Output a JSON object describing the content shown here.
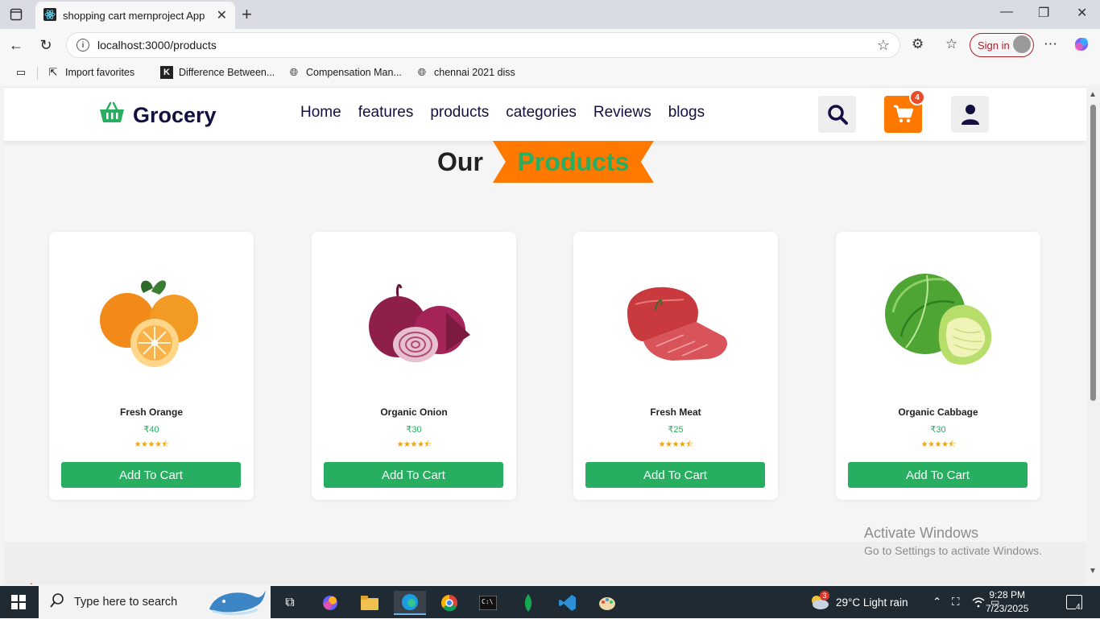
{
  "browser": {
    "tab_title": "shopping cart mernproject App",
    "url": "localhost:3000/products",
    "sign_in": "Sign in",
    "favorites": [
      {
        "label": "Import favorites",
        "icon": "import-icon"
      },
      {
        "label": "Difference Between...",
        "icon": "k-icon"
      },
      {
        "label": "Compensation Man...",
        "icon": "globe-icon"
      },
      {
        "label": "chennai 2021 diss",
        "icon": "globe-icon"
      }
    ]
  },
  "site": {
    "logo": "Grocery",
    "nav": [
      "Home",
      "features",
      "products",
      "categories",
      "Reviews",
      "blogs"
    ],
    "cart_count": "4",
    "heading_plain": "Our",
    "heading_highlight": "Products",
    "products": [
      {
        "name": "Fresh Orange",
        "price": "₹40",
        "rating": "★★★★⯪",
        "button": "Add To Cart",
        "image": "orange"
      },
      {
        "name": "Organic Onion",
        "price": "₹30",
        "rating": "★★★★⯪",
        "button": "Add To Cart",
        "image": "onion"
      },
      {
        "name": "Fresh Meat",
        "price": "₹25",
        "rating": "★★★★⯪",
        "button": "Add To Cart",
        "image": "meat"
      },
      {
        "name": "Organic Cabbage",
        "price": "₹30",
        "rating": "★★★★⯪",
        "button": "Add To Cart",
        "image": "cabbage"
      }
    ]
  },
  "watermark": {
    "line1": "Activate Windows",
    "line2": "Go to Settings to activate Windows."
  },
  "taskbar": {
    "search_placeholder": "Type here to search",
    "weather": "29°C  Light rain",
    "weather_badge": "3",
    "time": "9:28 PM",
    "date": "7/23/2025",
    "notification_count": "4"
  },
  "colors": {
    "accent": "#ff7800",
    "green": "#27ae60",
    "dark": "#130f40"
  }
}
